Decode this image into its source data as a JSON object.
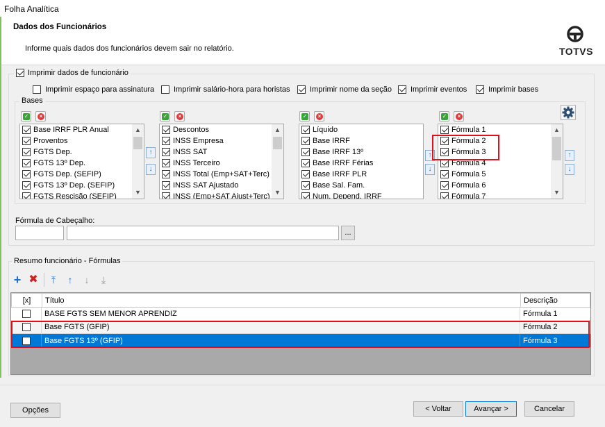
{
  "window": {
    "title": "Folha Analítica"
  },
  "header": {
    "title": "Dados dos Funcionários",
    "subtitle": "Informe quais dados dos funcionários devem sair no relatório.",
    "logo_text": "TOTVS"
  },
  "print_group": {
    "label": "Imprimir dados de funcionário",
    "checked": true,
    "options": [
      {
        "label": "Imprimir espaço para assinatura",
        "checked": false
      },
      {
        "label": "Imprimir salário-hora para horistas",
        "checked": false
      },
      {
        "label": "Imprimir nome da seção",
        "checked": true
      },
      {
        "label": "Imprimir eventos",
        "checked": true
      },
      {
        "label": "Imprimir bases",
        "checked": true
      }
    ]
  },
  "bases": {
    "label": "Bases",
    "lists": [
      {
        "items": [
          "Base IRRF PLR Anual",
          "Proventos",
          "FGTS Dep.",
          "FGTS 13º Dep.",
          "FGTS Dep. (SEFIP)",
          "FGTS 13º Dep. (SEFIP)",
          "FGTS Rescisão (SEFIP)"
        ]
      },
      {
        "items": [
          "Descontos",
          "INSS Empresa",
          "INSS SAT",
          "INSS Terceiro",
          "INSS Total (Emp+SAT+Terc)",
          "INSS SAT Ajustado",
          "INSS (Emp+SAT Ajust+Terc)"
        ]
      },
      {
        "items": [
          "Líquido",
          "Base IRRF",
          "Base IRRF 13º",
          "Base IRRF Férias",
          "Base IRRF PLR",
          "Base Sal. Fam.",
          "Num. Depend. IRRF"
        ]
      },
      {
        "items": [
          "Fórmula 1",
          "Fórmula 2",
          "Fórmula 3",
          "Fórmula 4",
          "Fórmula 5",
          "Fórmula 6",
          "Fórmula 7"
        ]
      }
    ]
  },
  "formula_header": {
    "label": "Fórmula de Cabeçalho:",
    "code_value": "",
    "desc_value": "",
    "browse_label": "..."
  },
  "summary": {
    "label": "Resumo funcionário - Fórmulas",
    "columns": [
      "[x]",
      "Título",
      "Descrição"
    ],
    "rows": [
      {
        "title": "BASE FGTS SEM MENOR APRENDIZ",
        "description": "Fórmula 1",
        "checked": false
      },
      {
        "title": "Base FGTS (GFIP)",
        "description": "Fórmula 2",
        "checked": false
      },
      {
        "title": "Base FGTS 13º (GFIP)",
        "description": "Fórmula 3",
        "checked": false
      }
    ]
  },
  "footer": {
    "options": "Opções",
    "back": "< Voltar",
    "next": "Avançar >",
    "cancel": "Cancelar"
  },
  "colors": {
    "selected_row": "#0078d7",
    "highlight": "#e0101a",
    "accent": "#7ec25b"
  }
}
